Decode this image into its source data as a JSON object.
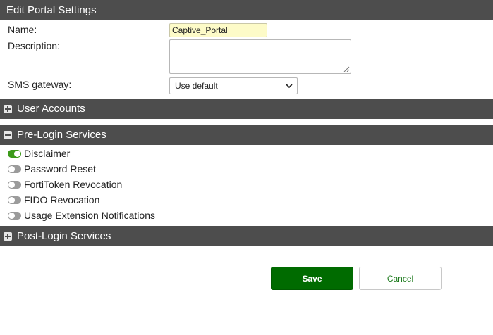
{
  "header": {
    "title": "Edit Portal Settings"
  },
  "form": {
    "name_label": "Name:",
    "name_value": "Captive_Portal",
    "description_label": "Description:",
    "description_value": "",
    "sms_label": "SMS gateway:",
    "sms_selected": "Use default"
  },
  "sections": {
    "user_accounts": {
      "label": "User Accounts",
      "expanded": false
    },
    "pre_login": {
      "label": "Pre-Login Services",
      "expanded": true,
      "items": [
        {
          "label": "Disclaimer",
          "enabled": true
        },
        {
          "label": "Password Reset",
          "enabled": false
        },
        {
          "label": "FortiToken Revocation",
          "enabled": false
        },
        {
          "label": "FIDO Revocation",
          "enabled": false
        },
        {
          "label": "Usage Extension Notifications",
          "enabled": false
        }
      ]
    },
    "post_login": {
      "label": "Post-Login Services",
      "expanded": false
    }
  },
  "buttons": {
    "save": "Save",
    "cancel": "Cancel"
  },
  "colors": {
    "header_bg": "#4d4d4d",
    "accent_green": "#006b00",
    "toggle_on": "#3c9a1a",
    "toggle_off": "#9b9b9b",
    "name_input_bg": "#fdfbc8"
  }
}
